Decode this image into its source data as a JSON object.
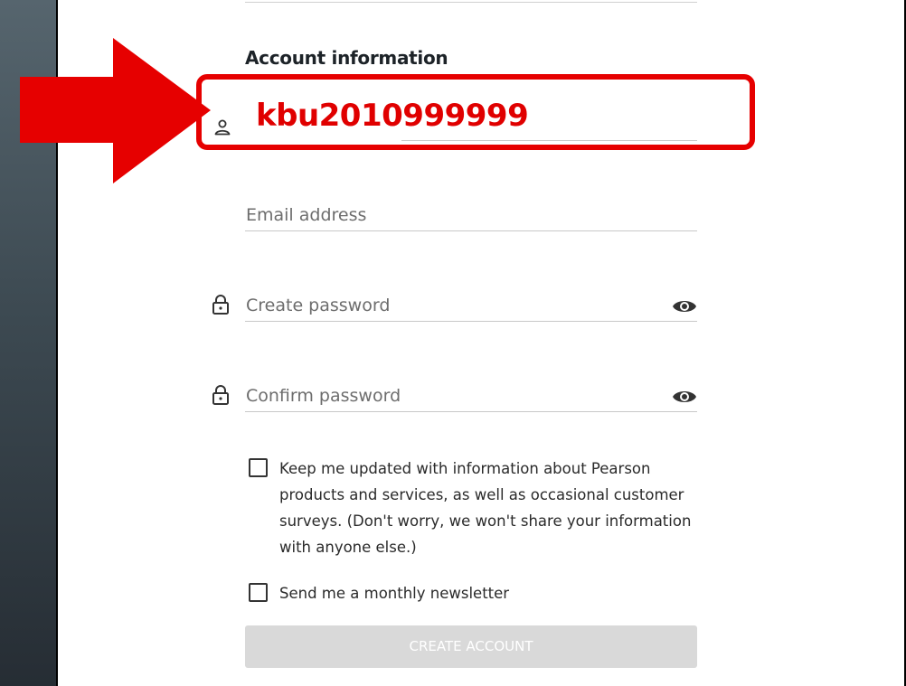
{
  "form": {
    "section_title": "Account information",
    "username": {
      "value": "kbu2010999999",
      "icon": "user-icon"
    },
    "email": {
      "placeholder": "Email address"
    },
    "create_password": {
      "placeholder": "Create password",
      "icon": "lock-icon",
      "toggle_icon": "eye-icon"
    },
    "confirm_password": {
      "placeholder": "Confirm password",
      "icon": "lock-icon",
      "toggle_icon": "eye-icon"
    },
    "updates_checkbox": {
      "label": "Keep me updated with information about Pearson products and services, as well as occasional customer surveys. (Don't worry, we won't share your information with anyone else.)",
      "checked": false
    },
    "newsletter_checkbox": {
      "label": "Send me a monthly newsletter",
      "checked": false
    },
    "submit_label": "CREATE ACCOUNT"
  },
  "annotation": {
    "highlight_color": "#e60000",
    "arrow_color": "#e60000"
  },
  "colors": {
    "button_disabled": "#d9d9d9",
    "text": "#2a2a2a",
    "placeholder": "#6d6d6d"
  }
}
